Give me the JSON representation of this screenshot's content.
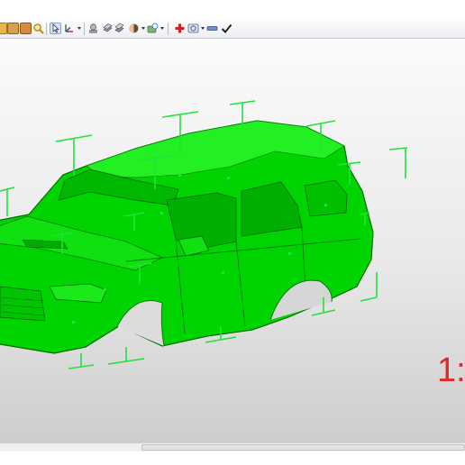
{
  "toolbar": {
    "icons": [
      "cube-icon",
      "save-icon",
      "open-file-icon",
      "zoom-icon",
      "select-arrow-icon",
      "transform-axis-icon",
      "mesh-layer-icon",
      "mesh-stack-icon",
      "shading-sphere-icon",
      "view-options-icon",
      "add-icon",
      "measure-icon",
      "rectangle-icon",
      "checkmark-icon"
    ],
    "colors": {
      "add_icon": "#d42020",
      "checkmark_icon": "#222222",
      "selected_tool_bg": "#cfe3fb"
    }
  },
  "viewport": {
    "model_color": "#00d400",
    "gizmo_color": "#22e23a",
    "background_top": "#fbfbfb",
    "background_bottom": "#cdcdcd"
  },
  "scale_label": {
    "text": "1:",
    "color": "#e02a2a"
  }
}
